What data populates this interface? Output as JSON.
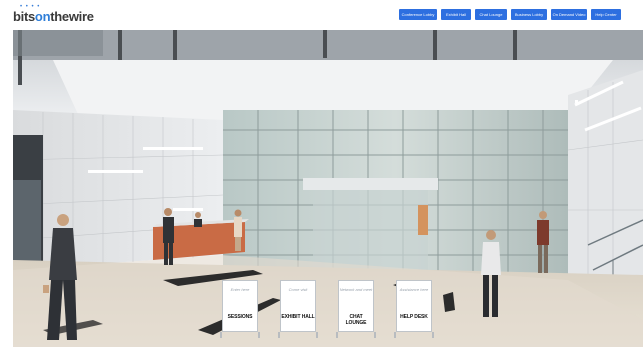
{
  "header": {
    "logo": {
      "part1": "bits",
      "part2": "on",
      "part3": "thewire",
      "dots": "• • • •"
    },
    "nav": [
      {
        "label": "Conference Lobby"
      },
      {
        "label": "Exhibit Hall"
      },
      {
        "label": "Chat Lounge"
      },
      {
        "label": "Business Lobby"
      },
      {
        "label": "On Demand Video"
      },
      {
        "label": "Help Center"
      }
    ]
  },
  "signs": [
    {
      "script": "Enter here",
      "label": "SESSIONS"
    },
    {
      "script": "Come visit",
      "label": "EXHIBIT HALL"
    },
    {
      "script": "Network and meet",
      "label": "CHAT LOUNGE"
    },
    {
      "script": "Assistance here",
      "label": "HELP DESK"
    }
  ],
  "colors": {
    "nav_bg": "#2d6fe0",
    "logo_blue": "#2f7ed8"
  }
}
